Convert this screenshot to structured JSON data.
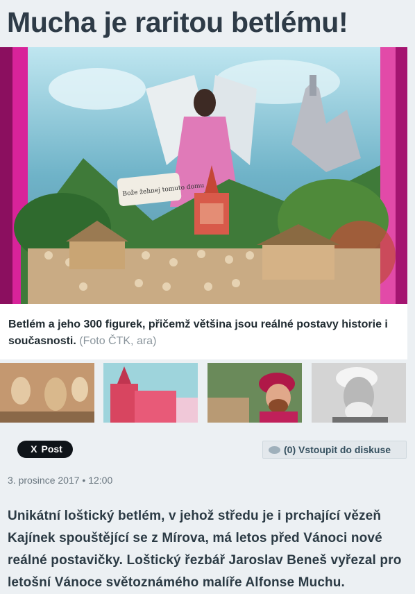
{
  "article": {
    "title": "Mucha je raritou betlému!",
    "caption_main": "Betlém a jeho 300 figurek, přičemž většina jsou reálné postavy historie i současnosti.",
    "caption_credit": "(Foto ČTK, ara)",
    "date": "3. prosince 2017 • 12:00",
    "lead": "Unikátní loštický betlém, v jehož středu je i prchající vězeň Kajínek spouštějící se z Mírova, má letos před Vánoci nové reálné postavičky. Loštický řezbář Jaroslav Beneš vyřezal pro letošní Vánoce světoznámého malíře Alfonse Muchu."
  },
  "photo": {
    "banner_text": "Bože žehnej tomuto domu"
  },
  "share": {
    "post_icon": "X",
    "post_label": "Post"
  },
  "discussion": {
    "icon": "speech-bubble-icon",
    "label": "(0) Vstoupit do diskuse"
  },
  "colors": {
    "page_bg": "#ecf0f3",
    "title": "#2e3b47",
    "post_button": "#0f1419",
    "discuss_button": "#e3e8ec"
  }
}
